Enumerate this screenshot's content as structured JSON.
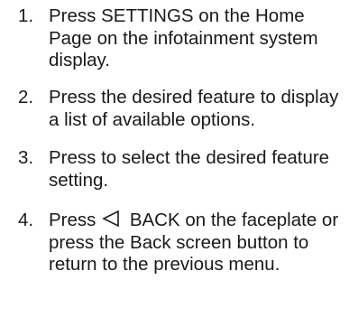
{
  "steps": [
    {
      "number": "1.",
      "text": "Press SETTINGS on the Home Page on the infotainment system display."
    },
    {
      "number": "2.",
      "text": "Press the desired feature to display a list of available options."
    },
    {
      "number": "3.",
      "text": "Press to select the desired feature setting."
    },
    {
      "number": "4.",
      "before_icon": "Press",
      "icon": "back-triangle-icon",
      "after_icon": "BACK on the faceplate or press the Back screen button to return to the previous menu."
    }
  ]
}
